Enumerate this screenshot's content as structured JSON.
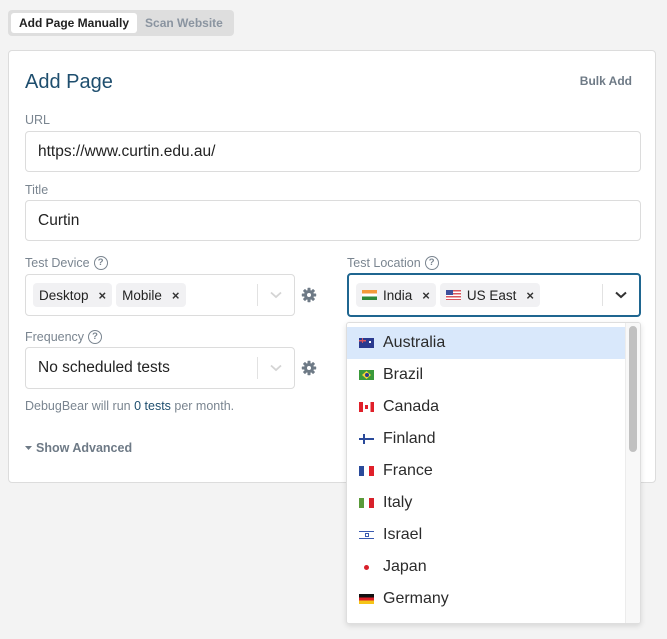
{
  "tabs": [
    {
      "label": "Add Page Manually",
      "active": true
    },
    {
      "label": "Scan Website",
      "active": false
    }
  ],
  "card": {
    "title": "Add Page",
    "bulk_add_label": "Bulk Add"
  },
  "form": {
    "url": {
      "label": "URL",
      "value": "https://www.curtin.edu.au/"
    },
    "title": {
      "label": "Title",
      "value": "Curtin"
    },
    "test_device": {
      "label": "Test Device",
      "help_icon": "question-circle-icon",
      "chips": [
        {
          "label": "Desktop"
        },
        {
          "label": "Mobile"
        }
      ],
      "remove_glyph": "×"
    },
    "test_location": {
      "label": "Test Location",
      "help_icon": "question-circle-icon",
      "chips": [
        {
          "label": "India",
          "flag": "in"
        },
        {
          "label": "US East",
          "flag": "us"
        }
      ],
      "remove_glyph": "×"
    },
    "frequency": {
      "label": "Frequency",
      "help_icon": "question-circle-icon",
      "value": "No scheduled tests"
    },
    "hint": {
      "prefix": "DebugBear will run ",
      "highlight": "0 tests",
      "suffix": " per month."
    },
    "show_advanced": "Show Advanced",
    "help_glyph": "?"
  },
  "location_dropdown": {
    "options": [
      {
        "label": "Australia",
        "flag": "au",
        "hovered": true
      },
      {
        "label": "Brazil",
        "flag": "br"
      },
      {
        "label": "Canada",
        "flag": "ca"
      },
      {
        "label": "Finland",
        "flag": "fi"
      },
      {
        "label": "France",
        "flag": "fr"
      },
      {
        "label": "Italy",
        "flag": "it"
      },
      {
        "label": "Israel",
        "flag": "il"
      },
      {
        "label": "Japan",
        "flag": "jp"
      },
      {
        "label": "Germany",
        "flag": "de"
      }
    ]
  },
  "colors": {
    "accent": "#1f6690",
    "title": "#1e4e6e",
    "muted": "#7a8590",
    "hover": "#d9e8fb"
  }
}
